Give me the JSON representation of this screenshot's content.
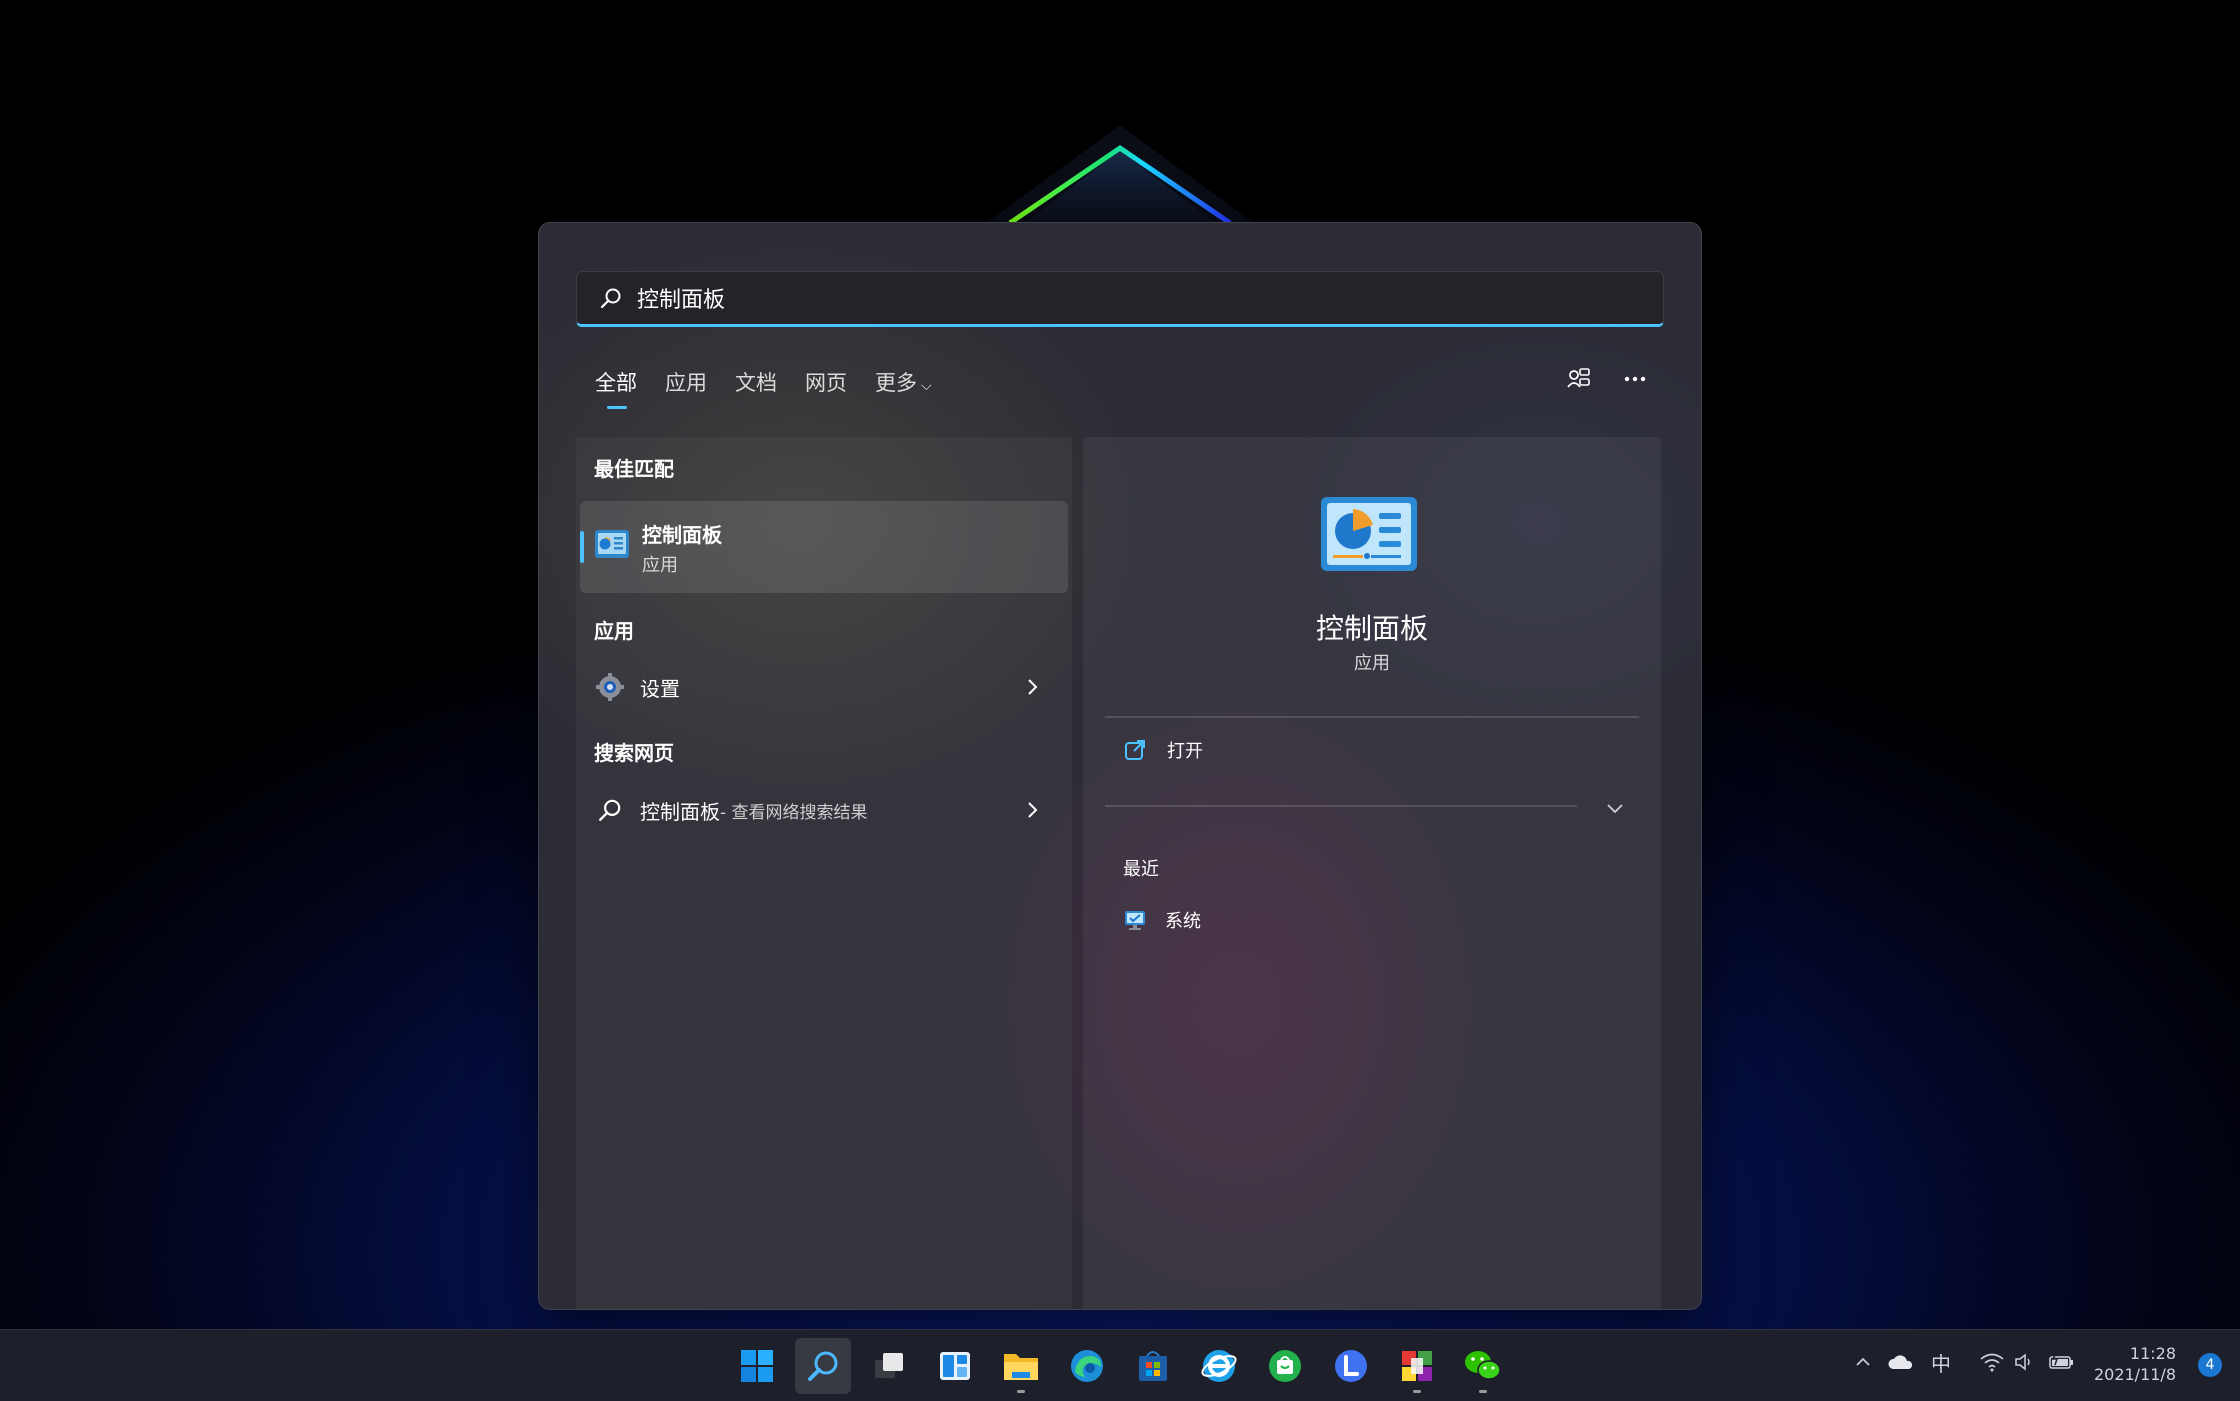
{
  "search": {
    "value": "控制面板"
  },
  "tabs": [
    {
      "label": "全部",
      "active": true
    },
    {
      "label": "应用"
    },
    {
      "label": "文档"
    },
    {
      "label": "网页"
    },
    {
      "label": "更多",
      "chevron": "chevron-down-icon"
    }
  ],
  "left": {
    "best_match_header": "最佳匹配",
    "best_match": {
      "name": "控制面板",
      "type": "应用",
      "icon": "control-panel-icon"
    },
    "apps_header": "应用",
    "apps": [
      {
        "name": "设置",
        "icon": "gear-icon"
      }
    ],
    "web_header": "搜索网页",
    "web_result": {
      "term": "控制面板",
      "suffix": " - 查看网络搜索结果",
      "icon": "search-icon"
    }
  },
  "right": {
    "title": "控制面板",
    "subtitle": "应用",
    "open_label": "打开",
    "recent_header": "最近",
    "recent_items": [
      {
        "name": "系统",
        "icon": "system-icon"
      }
    ]
  },
  "taskbar": {
    "apps": [
      "windows-start-icon",
      "search-icon",
      "task-view-icon",
      "widgets-icon",
      "file-explorer-icon",
      "edge-icon",
      "store-icon",
      "ie-icon",
      "wechat-store-icon",
      "lark-icon",
      "office-icon",
      "wechat-icon"
    ],
    "ime": "中",
    "time": "11:28",
    "date": "2021/11/8",
    "notification_count": "4"
  },
  "colors": {
    "accent": "#4cc2ff",
    "flyout_bg": "#2b2c35",
    "taskbar_bg": "#1d1f2a"
  }
}
